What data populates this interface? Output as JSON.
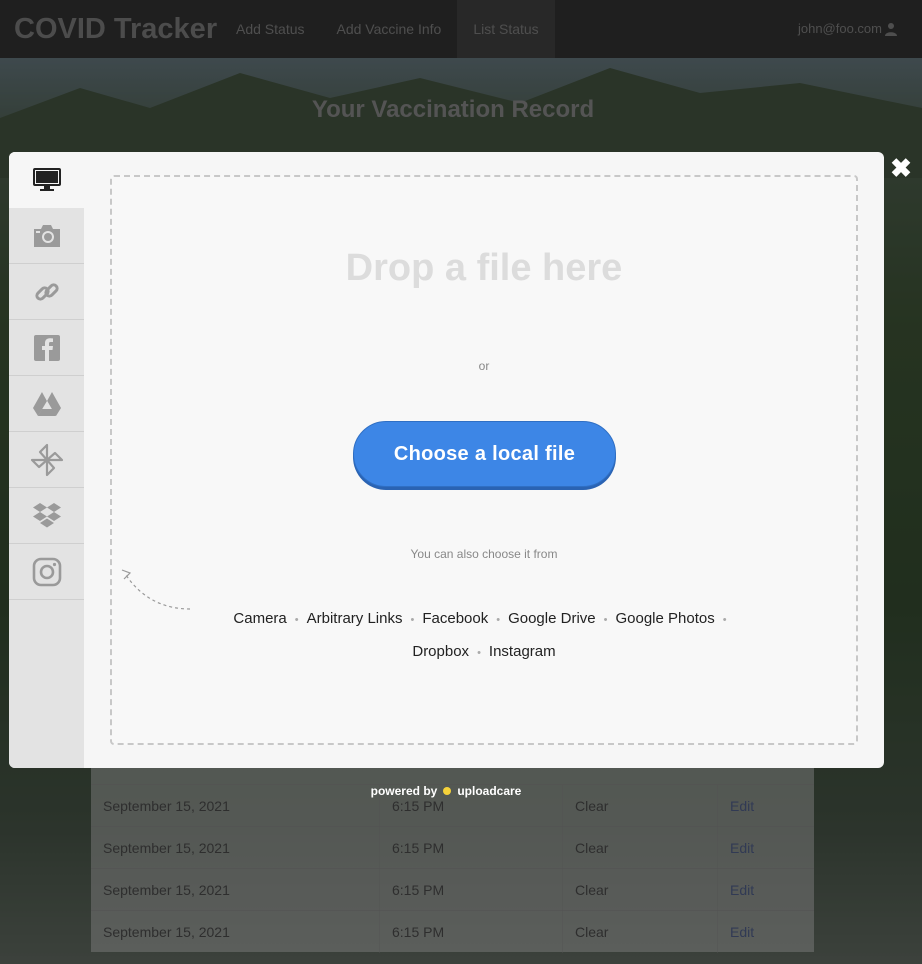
{
  "navbar": {
    "brand": "COVID Tracker",
    "links": [
      "Add Status",
      "Add Vaccine Info",
      "List Status"
    ],
    "active_link": "List Status",
    "user": "john@foo.com"
  },
  "page": {
    "heading": "Your Vaccination Record"
  },
  "table": {
    "rows": [
      {
        "date": "September 15, 2021",
        "time": "6:15 PM",
        "status": "Clear",
        "action": "Edit"
      },
      {
        "date": "September 15, 2021",
        "time": "6:15 PM",
        "status": "Clear",
        "action": "Edit"
      },
      {
        "date": "September 15, 2021",
        "time": "6:15 PM",
        "status": "Clear",
        "action": "Edit"
      },
      {
        "date": "September 15, 2021",
        "time": "6:15 PM",
        "status": "Clear",
        "action": "Edit"
      }
    ]
  },
  "uploader": {
    "tabs": [
      {
        "icon": "computer-icon"
      },
      {
        "icon": "camera-icon"
      },
      {
        "icon": "link-icon"
      },
      {
        "icon": "facebook-icon"
      },
      {
        "icon": "google-drive-icon"
      },
      {
        "icon": "google-photos-icon"
      },
      {
        "icon": "dropbox-icon"
      },
      {
        "icon": "instagram-icon"
      }
    ],
    "drop_title": "Drop a file here",
    "or_text": "or",
    "choose_button": "Choose a local file",
    "also_text": "You can also choose it from",
    "sources": [
      "Camera",
      "Arbitrary Links",
      "Facebook",
      "Google Drive",
      "Google Photos",
      "Dropbox",
      "Instagram"
    ],
    "close": "✖",
    "powered_by": "powered by",
    "brand": "uploadcare"
  },
  "colors": {
    "accent": "#3d86e6",
    "navbar": "#3a3a3a",
    "uploadcare_dot": "#f5d23a"
  }
}
